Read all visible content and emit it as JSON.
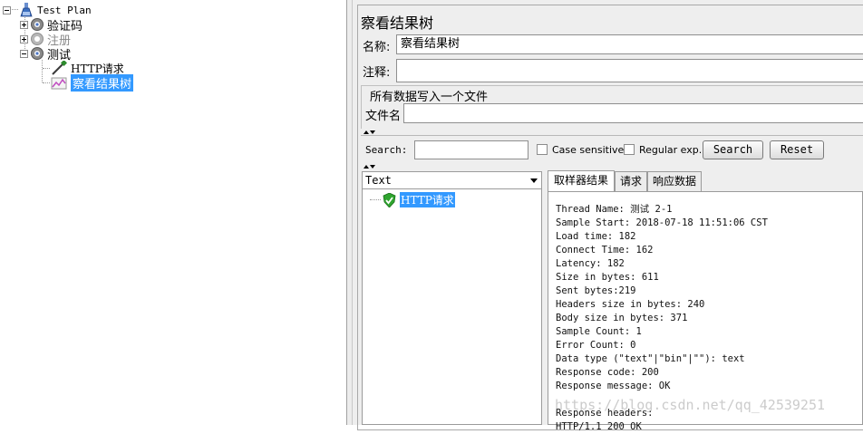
{
  "tree": {
    "root": "Test Plan",
    "items": [
      {
        "label": "验证码"
      },
      {
        "label": "注册"
      },
      {
        "label": "测试"
      }
    ],
    "children": [
      {
        "label": "HTTP请求"
      },
      {
        "label": "察看结果树"
      }
    ]
  },
  "panel": {
    "title": "察看结果树",
    "name_label": "名称:",
    "name_value": "察看结果树",
    "comment_label": "注释:",
    "comment_value": "",
    "file_group_title": "所有数据写入一个文件",
    "filename_label": "文件名",
    "filename_value": ""
  },
  "search": {
    "label": "Search:",
    "value": "",
    "case_sensitive_label": "Case sensitive",
    "regex_label": "Regular exp.",
    "search_button": "Search",
    "reset_button": "Reset"
  },
  "results": {
    "renderer": "Text",
    "sample_label": "HTTP请求",
    "tabs": [
      {
        "label": "取样器结果",
        "active": true
      },
      {
        "label": "请求",
        "active": false
      },
      {
        "label": "响应数据",
        "active": false
      }
    ],
    "detail_lines": [
      "Thread Name: 测试 2-1",
      "Sample Start: 2018-07-18 11:51:06 CST",
      "Load time: 182",
      "Connect Time: 162",
      "Latency: 182",
      "Size in bytes: 611",
      "Sent bytes:219",
      "Headers size in bytes: 240",
      "Body size in bytes: 371",
      "Sample Count: 1",
      "Error Count: 0",
      "Data type (\"text\"|\"bin\"|\"\"): text",
      "Response code: 200",
      "Response message: OK",
      "",
      "Response headers:",
      "HTTP/1.1 200 OK"
    ]
  },
  "watermark": "https://blog.csdn.net/qq_42539251",
  "colors": {
    "selection": "#3399ff",
    "panel_bg": "#eeeeee"
  }
}
